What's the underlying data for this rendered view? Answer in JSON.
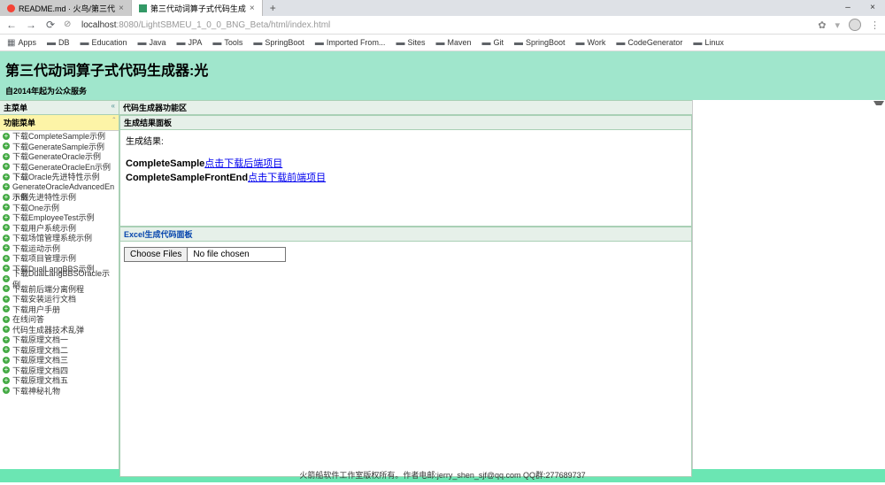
{
  "tabs": {
    "inactive": "README.md · 火鸟/第三代",
    "active": "第三代动词算子式代码生成",
    "close": "×",
    "newtab": "+"
  },
  "addr": {
    "shield": "⊘",
    "host": "localhost",
    "rest": ":8080/LightSBMEU_1_0_0_BNG_Beta/html/index.html"
  },
  "bookmarks": {
    "apps": "Apps",
    "items": [
      "DB",
      "Education",
      "Java",
      "JPA",
      "Tools",
      "SpringBoot",
      "Imported From...",
      "Sites",
      "Maven",
      "Git",
      "SpringBoot",
      "Work",
      "CodeGenerator",
      "Linux"
    ]
  },
  "header": {
    "title": "第三代动词算子式代码生成器:光",
    "sub": "自2014年起为公众服务"
  },
  "sidebar": {
    "main_title": "主菜单",
    "sub_title": "功能菜单",
    "items": [
      "下载CompleteSample示例",
      "下载GenerateSample示例",
      "下载GenerateOracle示例",
      "下载GenerateOracleEn示例",
      "下载Oracle先进特性示例",
      "下载GenerateOracleAdvancedEn示例",
      "下载先进特性示例",
      "下载One示例",
      "下载EmployeeTest示例",
      "下载用户系统示例",
      "下载场馆管理系统示例",
      "下载运动示例",
      "下载项目管理示例",
      "下载DualLangBBS示例",
      "下载DualLangBBSOracle示例",
      "下载前后端分离例程",
      "下载安装运行文档",
      "下载用户手册",
      "在线问答",
      "代码生成器技术乱弹",
      "下载原理文档一",
      "下载原理文档二",
      "下载原理文档三",
      "下载原理文档四",
      "下载原理文档五",
      "下载神秘礼物"
    ]
  },
  "content": {
    "area_title": "代码生成器功能区",
    "result_title": "生成结果面板",
    "result_label": "生成结果:",
    "line1_bold": "CompleteSample",
    "line1_link": "点击下载后端项目",
    "line2_bold": "CompleteSampleFrontEnd",
    "line2_link": "点击下载前端项目",
    "excel_title": "Excel生成代码面板",
    "choose_btn": "Choose Files",
    "no_file": "No file chosen"
  },
  "footer": "火箭船软件工作室版权所有。作者电邮:jerry_shen_sjf@qq.com QQ群:277689737"
}
